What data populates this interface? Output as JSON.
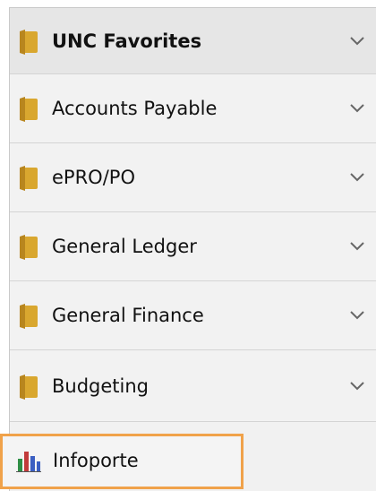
{
  "menu": {
    "items": [
      {
        "label": "UNC Favorites",
        "icon": "folder-icon"
      },
      {
        "label": "Accounts Payable",
        "icon": "folder-icon"
      },
      {
        "label": "ePRO/PO",
        "icon": "folder-icon"
      },
      {
        "label": "General Ledger",
        "icon": "folder-icon"
      },
      {
        "label": "General Finance",
        "icon": "folder-icon"
      },
      {
        "label": "Budgeting",
        "icon": "folder-icon"
      }
    ],
    "expand_icon": "chevron-down-icon"
  },
  "infoporte": {
    "label": "Infoporte",
    "icon": "bar-chart-icon"
  },
  "colors": {
    "folder": "#d9a72f",
    "folder_dark": "#b8861e",
    "highlight_border": "#f0a24a",
    "chevron": "#666666"
  }
}
